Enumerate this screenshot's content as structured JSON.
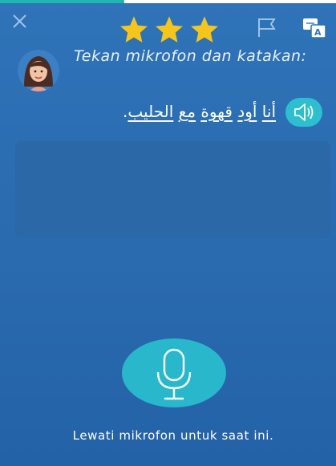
{
  "header": {
    "progress_fraction": 0.37,
    "stars_count": 3,
    "icons": {
      "close": "close-icon",
      "flag": "flag-icon",
      "translate": "translate-icon"
    }
  },
  "prompt": {
    "instruction": "Tekan mikrofon dan katakan:",
    "avatar": "woman-avatar"
  },
  "phrase": {
    "words": [
      "أنا",
      "أود",
      "قهوة",
      "مع",
      "الحليب"
    ],
    "end_punct": ".",
    "audio_icon": "speaker-icon"
  },
  "mic": {
    "icon": "microphone-icon"
  },
  "footer": {
    "skip_label": "Lewati mikrofon untuk saat ini."
  },
  "colors": {
    "background": "#2f73b8",
    "accent_teal": "#29b7cc",
    "star": "#f6c51b",
    "progress": "#1fb5b0"
  }
}
